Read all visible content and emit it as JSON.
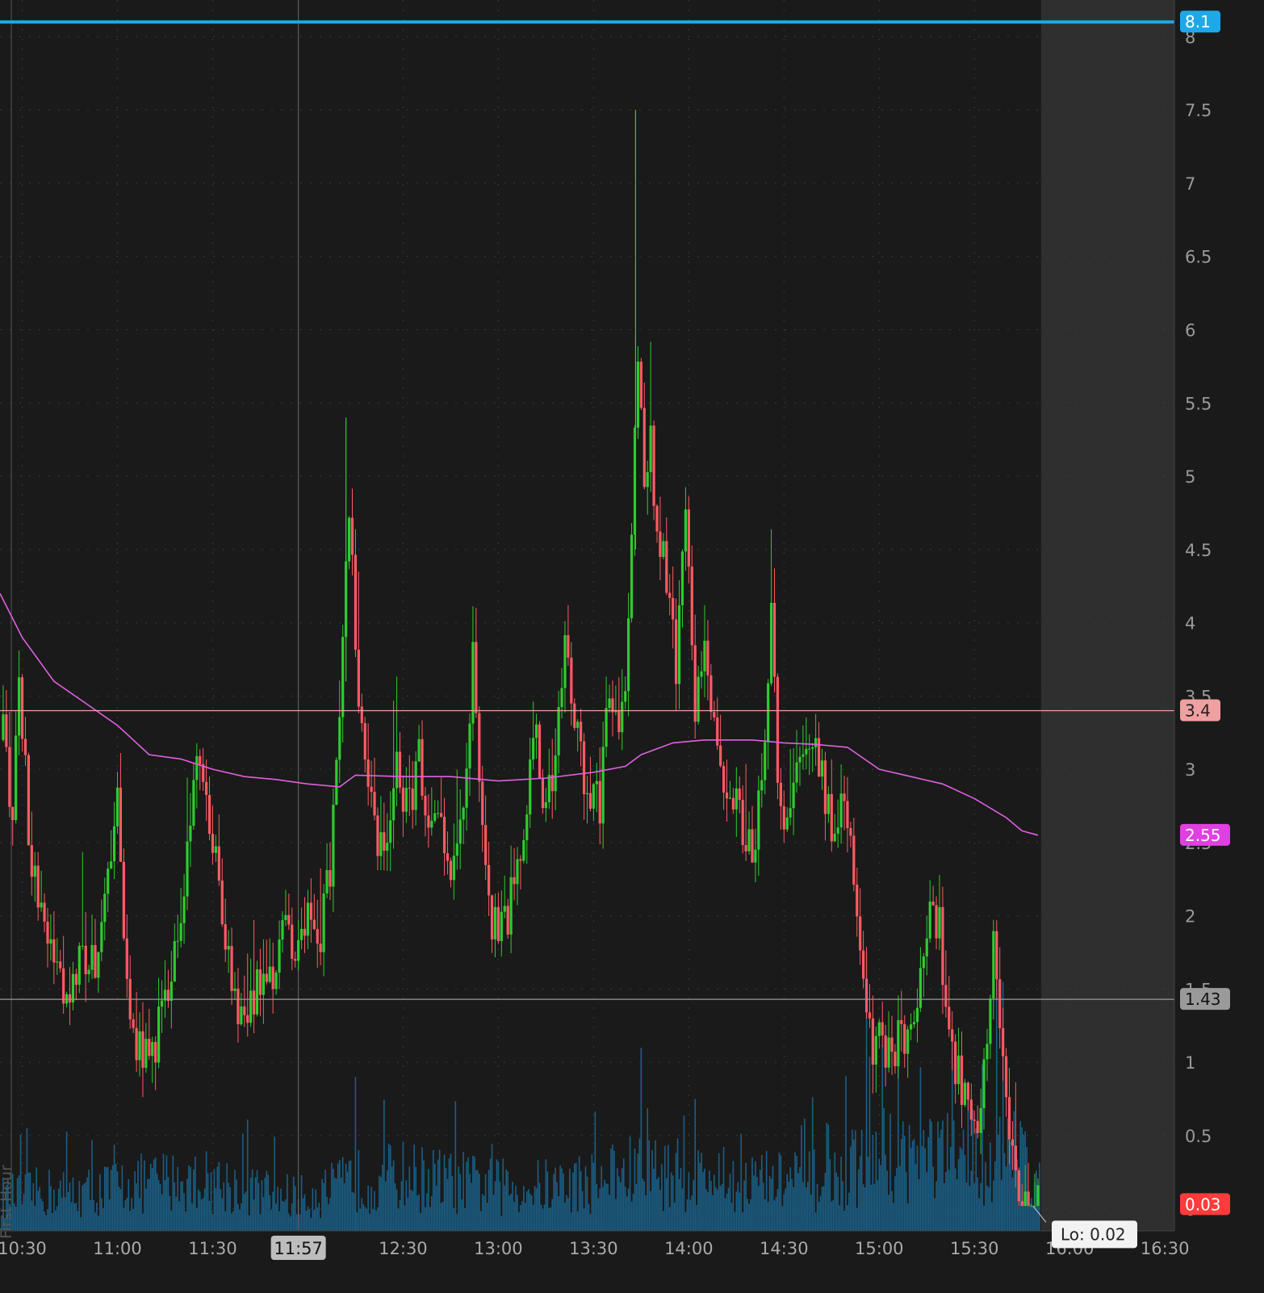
{
  "chart_data": {
    "type": "candlestick",
    "ylim": [
      -0.15,
      8.25
    ],
    "y_ticks": [
      "0",
      "0.5",
      "1",
      "1.5",
      "2",
      "2.5",
      "3",
      "3.5",
      "4",
      "4.5",
      "5",
      "5.5",
      "6",
      "6.5",
      "7",
      "7.5",
      "8"
    ],
    "x_ticks": [
      "10:30",
      "11:00",
      "11:30",
      "11:57",
      "12:30",
      "13:00",
      "13:30",
      "14:00",
      "14:30",
      "15:00",
      "15:30",
      "16:00",
      "16:30"
    ],
    "x_range": [
      "10:23",
      "16:33"
    ],
    "cursor_time": "11:57",
    "extended_hours_start": "15:51",
    "price_lines": [
      {
        "value": 8.1,
        "label": "8.1",
        "color": "#1fa8e8"
      },
      {
        "value": 3.4,
        "label": "3.4",
        "color": "#f0a0a0"
      },
      {
        "value": 1.43,
        "label": "1.43",
        "color": "#9a9a9a"
      }
    ],
    "price_bubbles": [
      {
        "value": 2.55,
        "label": "2.55",
        "color": "#e040e0"
      },
      {
        "value": 0.03,
        "label": "0.03",
        "color": "#ff3b3b"
      }
    ],
    "lo_label": "Lo: 0.02",
    "side_label": "First Hour",
    "up_color": "#2ecc2e",
    "down_color": "#ff5a64",
    "ma_color": "#e060e0",
    "volume_color": "#1a5f85",
    "close_path": [
      [
        "10:24",
        3.2
      ],
      [
        "10:27",
        2.7
      ],
      [
        "10:29",
        3.6
      ],
      [
        "10:32",
        2.6
      ],
      [
        "10:35",
        2.1
      ],
      [
        "10:40",
        1.7
      ],
      [
        "10:44",
        1.4
      ],
      [
        "10:48",
        1.8
      ],
      [
        "10:53",
        1.6
      ],
      [
        "10:56",
        2.0
      ],
      [
        "11:00",
        2.7
      ],
      [
        "11:03",
        1.4
      ],
      [
        "11:07",
        1.1
      ],
      [
        "11:10",
        1.0
      ],
      [
        "11:14",
        1.3
      ],
      [
        "11:18",
        1.7
      ],
      [
        "11:21",
        2.3
      ],
      [
        "11:25",
        3.2
      ],
      [
        "11:28",
        2.9
      ],
      [
        "11:31",
        2.4
      ],
      [
        "11:34",
        1.9
      ],
      [
        "11:37",
        1.4
      ],
      [
        "11:41",
        1.2
      ],
      [
        "11:44",
        1.6
      ],
      [
        "11:48",
        1.5
      ],
      [
        "11:52",
        1.9
      ],
      [
        "11:56",
        1.7
      ],
      [
        "12:00",
        2.1
      ],
      [
        "12:03",
        1.8
      ],
      [
        "12:07",
        2.3
      ],
      [
        "12:10",
        3.5
      ],
      [
        "12:13",
        4.7
      ],
      [
        "12:16",
        3.5
      ],
      [
        "12:18",
        3.0
      ],
      [
        "12:21",
        2.6
      ],
      [
        "12:25",
        2.4
      ],
      [
        "12:28",
        3.0
      ],
      [
        "12:32",
        2.7
      ],
      [
        "12:35",
        3.2
      ],
      [
        "12:38",
        2.5
      ],
      [
        "12:42",
        2.8
      ],
      [
        "12:45",
        2.2
      ],
      [
        "12:49",
        2.8
      ],
      [
        "12:52",
        3.7
      ],
      [
        "12:55",
        2.6
      ],
      [
        "12:58",
        2.0
      ],
      [
        "13:01",
        1.9
      ],
      [
        "13:04",
        2.1
      ],
      [
        "13:08",
        2.6
      ],
      [
        "13:12",
        3.3
      ],
      [
        "13:15",
        2.7
      ],
      [
        "13:18",
        3.1
      ],
      [
        "13:21",
        3.9
      ],
      [
        "13:24",
        3.3
      ],
      [
        "13:28",
        2.9
      ],
      [
        "13:32",
        2.8
      ],
      [
        "13:35",
        3.5
      ],
      [
        "13:38",
        3.3
      ],
      [
        "13:40",
        3.7
      ],
      [
        "13:42",
        4.5
      ],
      [
        "13:44",
        5.9
      ],
      [
        "13:46",
        4.9
      ],
      [
        "13:48",
        5.3
      ],
      [
        "13:50",
        4.6
      ],
      [
        "13:53",
        4.3
      ],
      [
        "13:56",
        3.7
      ],
      [
        "13:59",
        4.7
      ],
      [
        "14:02",
        3.3
      ],
      [
        "14:05",
        3.9
      ],
      [
        "14:08",
        3.2
      ],
      [
        "14:11",
        2.7
      ],
      [
        "14:14",
        2.8
      ],
      [
        "14:17",
        2.6
      ],
      [
        "14:20",
        2.4
      ],
      [
        "14:23",
        3.0
      ],
      [
        "14:26",
        4.0
      ],
      [
        "14:29",
        2.6
      ],
      [
        "14:32",
        2.7
      ],
      [
        "14:35",
        3.0
      ],
      [
        "14:38",
        3.3
      ],
      [
        "14:42",
        2.9
      ],
      [
        "14:45",
        2.6
      ],
      [
        "14:49",
        2.8
      ],
      [
        "14:52",
        2.3
      ],
      [
        "14:55",
        1.6
      ],
      [
        "14:58",
        1.0
      ],
      [
        "15:01",
        1.2
      ],
      [
        "15:04",
        0.9
      ],
      [
        "15:07",
        1.3
      ],
      [
        "15:10",
        1.1
      ],
      [
        "15:13",
        1.6
      ],
      [
        "15:16",
        2.2
      ],
      [
        "15:19",
        1.9
      ],
      [
        "15:22",
        1.2
      ],
      [
        "15:25",
        0.9
      ],
      [
        "15:28",
        0.7
      ],
      [
        "15:31",
        0.6
      ],
      [
        "15:34",
        1.0
      ],
      [
        "15:36",
        1.9
      ],
      [
        "15:38",
        1.2
      ],
      [
        "15:40",
        0.6
      ],
      [
        "15:43",
        0.15
      ],
      [
        "15:46",
        0.04
      ],
      [
        "15:50",
        0.03
      ]
    ],
    "moving_average": [
      [
        "10:23",
        4.2
      ],
      [
        "10:30",
        3.9
      ],
      [
        "10:40",
        3.6
      ],
      [
        "10:50",
        3.45
      ],
      [
        "11:00",
        3.3
      ],
      [
        "11:10",
        3.1
      ],
      [
        "11:20",
        3.07
      ],
      [
        "11:30",
        3.0
      ],
      [
        "11:40",
        2.95
      ],
      [
        "11:50",
        2.93
      ],
      [
        "12:00",
        2.9
      ],
      [
        "12:10",
        2.88
      ],
      [
        "12:15",
        2.96
      ],
      [
        "12:30",
        2.95
      ],
      [
        "12:45",
        2.95
      ],
      [
        "13:00",
        2.92
      ],
      [
        "13:15",
        2.94
      ],
      [
        "13:30",
        2.98
      ],
      [
        "13:40",
        3.02
      ],
      [
        "13:45",
        3.1
      ],
      [
        "13:55",
        3.18
      ],
      [
        "14:05",
        3.2
      ],
      [
        "14:20",
        3.2
      ],
      [
        "14:30",
        3.18
      ],
      [
        "14:40",
        3.17
      ],
      [
        "14:50",
        3.15
      ],
      [
        "15:00",
        3.0
      ],
      [
        "15:10",
        2.95
      ],
      [
        "15:20",
        2.9
      ],
      [
        "15:30",
        2.8
      ],
      [
        "15:40",
        2.67
      ],
      [
        "15:45",
        2.58
      ],
      [
        "15:50",
        2.55
      ]
    ],
    "volume_profile": [
      [
        "10:23",
        0.3
      ],
      [
        "10:35",
        0.35
      ],
      [
        "10:50",
        0.35
      ],
      [
        "11:00",
        0.4
      ],
      [
        "11:15",
        0.45
      ],
      [
        "11:30",
        0.45
      ],
      [
        "11:45",
        0.35
      ],
      [
        "12:00",
        0.3
      ],
      [
        "12:15",
        0.45
      ],
      [
        "12:30",
        0.5
      ],
      [
        "12:45",
        0.45
      ],
      [
        "13:00",
        0.4
      ],
      [
        "13:15",
        0.4
      ],
      [
        "13:30",
        0.45
      ],
      [
        "13:45",
        0.55
      ],
      [
        "14:00",
        0.5
      ],
      [
        "14:15",
        0.45
      ],
      [
        "14:30",
        0.45
      ],
      [
        "14:45",
        0.45
      ],
      [
        "15:00",
        0.7
      ],
      [
        "15:15",
        0.7
      ],
      [
        "15:30",
        0.6
      ],
      [
        "15:45",
        0.7
      ],
      [
        "15:51",
        0.4
      ]
    ],
    "volume_spikes": [
      [
        "12:15",
        1.05
      ],
      [
        "13:45",
        1.25
      ],
      [
        "14:02",
        0.9
      ],
      [
        "14:56",
        1.9
      ],
      [
        "15:37",
        2.0
      ],
      [
        "15:39",
        1.7
      ]
    ]
  }
}
